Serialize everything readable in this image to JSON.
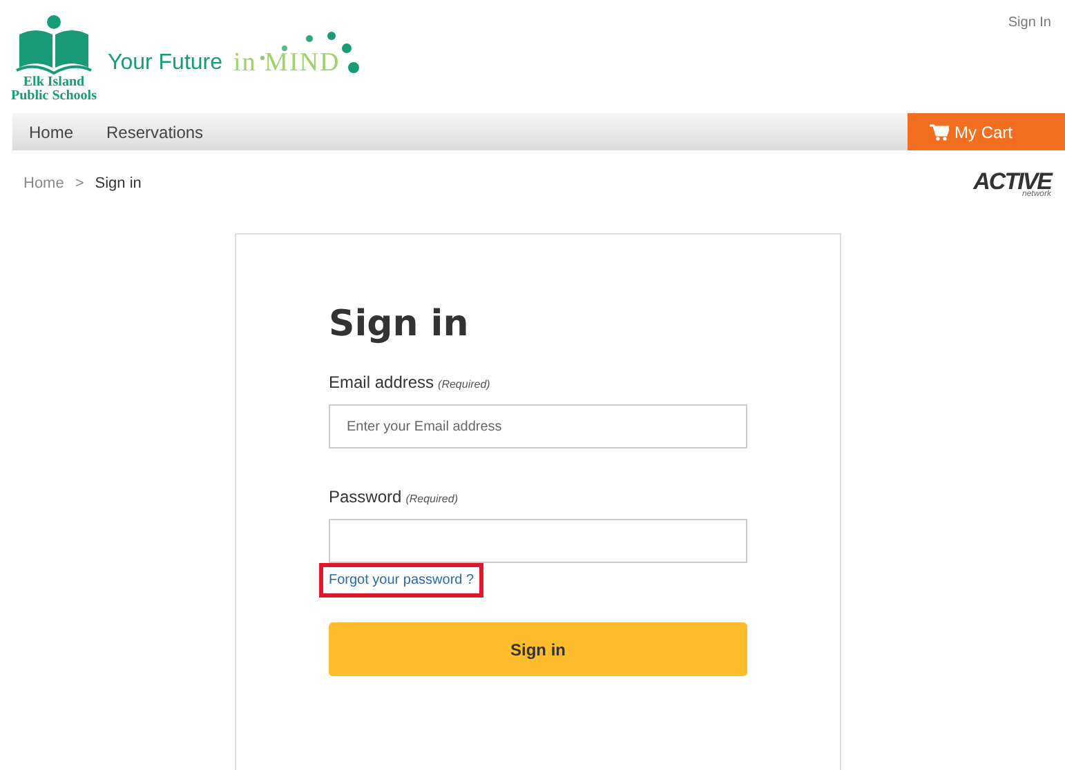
{
  "header": {
    "logo": {
      "school_name": "Elk Island Public Schools",
      "tagline": "Your Future",
      "tagline_accent": "in MIND"
    },
    "sign_in_link": "Sign In"
  },
  "nav": {
    "items": [
      {
        "label": "Home"
      },
      {
        "label": "Reservations"
      }
    ],
    "cart": "My Cart"
  },
  "breadcrumb": {
    "items": [
      "Home",
      "Sign in"
    ],
    "separator": ">"
  },
  "partner_logo": {
    "name": "ACTIVE",
    "sub": "network"
  },
  "form": {
    "title": "Sign in",
    "fields": [
      {
        "label": "Email address",
        "note": "(Required)",
        "placeholder": "Enter your Email address"
      },
      {
        "label": "Password",
        "note": "(Required)"
      }
    ],
    "forgot_link": {
      "text": "Forgot your password ?",
      "highlighted": true
    },
    "submit": "Sign in"
  }
}
